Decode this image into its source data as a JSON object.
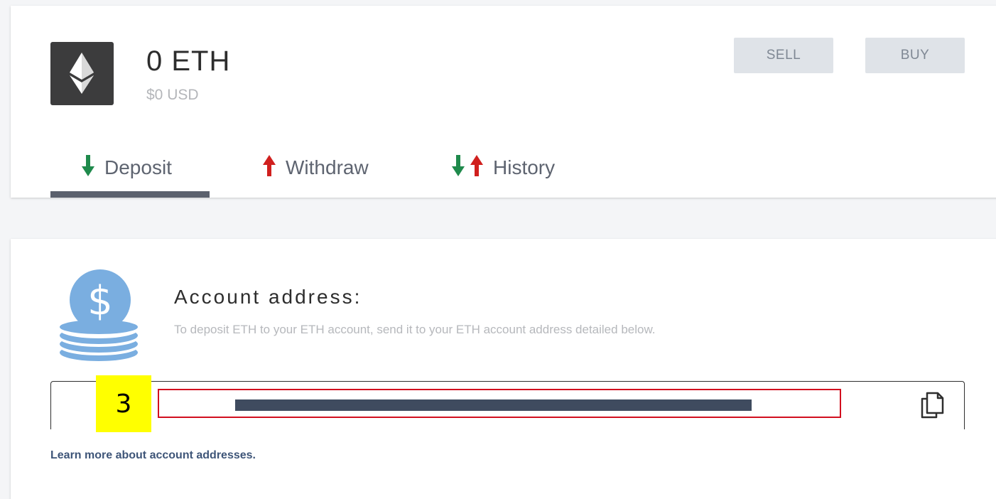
{
  "wallet": {
    "balance": "0 ETH",
    "fiat_value": "$0 USD",
    "logo_icon": "ethereum-icon",
    "logo_color": "#3c3c3d"
  },
  "actions": {
    "sell_label": "SELL",
    "buy_label": "BUY"
  },
  "tabs": [
    {
      "label": "Deposit",
      "icon": "arrow-down-icon",
      "active": true
    },
    {
      "label": "Withdraw",
      "icon": "arrow-up-icon",
      "active": false
    },
    {
      "label": "History",
      "icon": "arrows-up-down-icon",
      "active": false
    }
  ],
  "deposit": {
    "title": "Account address:",
    "description": "To deposit ETH to your ETH account, send it to your ETH account address detailed below.",
    "address": "",
    "copy_icon": "copy-icon",
    "learn_more_link": "Learn more about account addresses."
  },
  "annotation": {
    "step_number": "3",
    "badge_color": "#ffff00",
    "highlight_color": "#d20f1f"
  },
  "colors": {
    "deposit_arrow": "#1f8a4c",
    "withdraw_arrow": "#d0201e",
    "coin_blue": "#7aaee0",
    "active_tab_underline": "#5b616d"
  }
}
